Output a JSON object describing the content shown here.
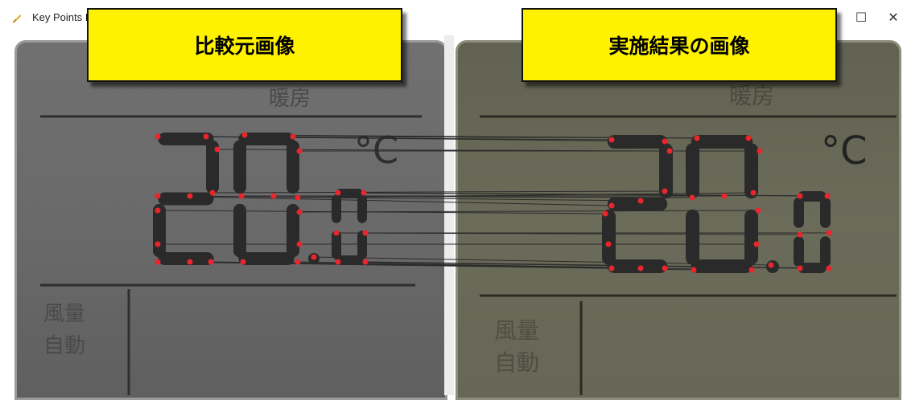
{
  "window": {
    "title": "Key Points I",
    "maximize_glyph": "☐",
    "close_glyph": "✕",
    "app_icon": "feather-icon"
  },
  "banners": {
    "left": "比較元画像",
    "right": "実施結果の画像"
  },
  "left_lcd": {
    "mode_label": "暖房",
    "temperature": "20.0",
    "unit": "°C",
    "fan_label": "風量",
    "auto_label": "自動"
  },
  "right_lcd": {
    "mode_label": "暖房",
    "temperature": "20.0",
    "unit": "°C",
    "fan_label": "風量",
    "auto_label": "自動"
  },
  "colors": {
    "banner_fill": "#fff200",
    "keypoint": "#e8262b",
    "match_line": "#2b2b2b",
    "lcd_segment": "#2a2a2a"
  }
}
